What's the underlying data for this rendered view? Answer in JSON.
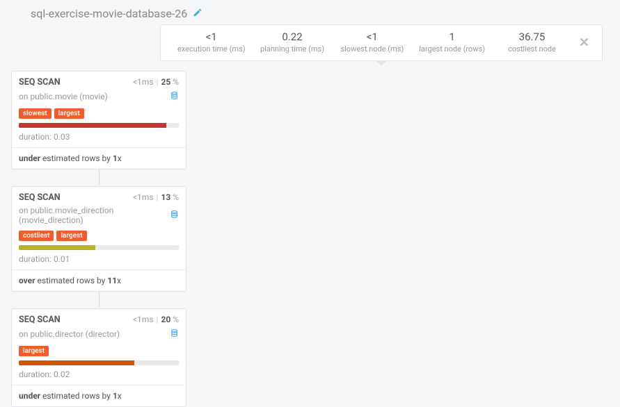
{
  "header": {
    "title": "sql-exercise-movie-database-26"
  },
  "stats": {
    "exec_time_value": "<1",
    "exec_time_label": "execution time (ms)",
    "plan_time_value": "0.22",
    "plan_time_label": "planning time (ms)",
    "slowest_value": "<1",
    "slowest_label": "slowest node (ms)",
    "largest_value": "1",
    "largest_label": "largest node (rows)",
    "costliest_value": "36.75",
    "costliest_label": "costliest node"
  },
  "nodes": [
    {
      "title": "SEQ SCAN",
      "time": "<1ms",
      "percent": "25",
      "pct_suffix": " %",
      "on_prefix": "on ",
      "relation": "public.movie (movie)",
      "tags": [
        "slowest",
        "largest"
      ],
      "bar_width": "92%",
      "bar_color": "#c0392b",
      "duration_label": "duration: ",
      "duration_val": "0.03",
      "est_word": "under",
      "est_mid": " estimated rows by ",
      "est_factor": "1",
      "est_suffix": "x"
    },
    {
      "title": "SEQ SCAN",
      "time": "<1ms",
      "percent": "13",
      "pct_suffix": " %",
      "on_prefix": "on ",
      "relation": "public.movie_direction (movie_direction)",
      "tags": [
        "costliest",
        "largest"
      ],
      "bar_width": "48%",
      "bar_color": "#b8b12a",
      "duration_label": "duration: ",
      "duration_val": "0.01",
      "est_word": "over",
      "est_mid": " estimated rows by ",
      "est_factor": "11",
      "est_suffix": "x"
    },
    {
      "title": "SEQ SCAN",
      "time": "<1ms",
      "percent": "20",
      "pct_suffix": " %",
      "on_prefix": "on ",
      "relation": "public.director (director)",
      "tags": [
        "largest"
      ],
      "bar_width": "72%",
      "bar_color": "#d35400",
      "duration_label": "duration: ",
      "duration_val": "0.02",
      "est_word": "under",
      "est_mid": " estimated rows by ",
      "est_factor": "1",
      "est_suffix": "x"
    }
  ]
}
